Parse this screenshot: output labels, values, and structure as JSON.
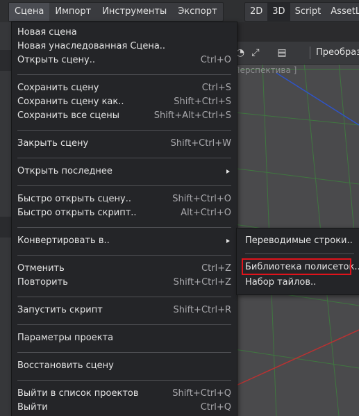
{
  "menubar": {
    "items": [
      "Сцена",
      "Импорт",
      "Инструменты",
      "Экспорт"
    ]
  },
  "modebar": {
    "items": [
      "2D",
      "3D",
      "Script",
      "AssetLib"
    ]
  },
  "viewport": {
    "toolbar_label": "Преобразова",
    "perspective_label": "[ Перспектива ]"
  },
  "scene_menu": {
    "items": [
      {
        "label": "Новая сцена",
        "shortcut": ""
      },
      {
        "label": "Новая унаследованная Сцена..",
        "shortcut": ""
      },
      {
        "label": "Открыть сцену..",
        "shortcut": "Ctrl+O"
      },
      {
        "label": "Сохранить сцену",
        "shortcut": "Ctrl+S"
      },
      {
        "label": "Сохранить сцену как..",
        "shortcut": "Shift+Ctrl+S"
      },
      {
        "label": "Сохранить все сцены",
        "shortcut": "Shift+Alt+Ctrl+S"
      },
      {
        "label": "Закрыть сцену",
        "shortcut": "Shift+Ctrl+W"
      },
      {
        "label": "Открыть последнее",
        "shortcut": ""
      },
      {
        "label": "Быстро открыть сцену..",
        "shortcut": "Shift+Ctrl+O"
      },
      {
        "label": "Быстро открыть скрипт..",
        "shortcut": "Alt+Ctrl+O"
      },
      {
        "label": "Конвертировать в..",
        "shortcut": ""
      },
      {
        "label": "Отменить",
        "shortcut": "Ctrl+Z"
      },
      {
        "label": "Повторить",
        "shortcut": "Shift+Ctrl+Z"
      },
      {
        "label": "Запустить скрипт",
        "shortcut": "Shift+Ctrl+R"
      },
      {
        "label": "Параметры проекта",
        "shortcut": ""
      },
      {
        "label": "Восстановить сцену",
        "shortcut": ""
      },
      {
        "label": "Выйти в список проектов",
        "shortcut": "Shift+Ctrl+Q"
      },
      {
        "label": "Выйти",
        "shortcut": "Ctrl+Q"
      }
    ]
  },
  "convert_submenu": {
    "items": [
      "Переводимые строки..",
      "Библиотека полисеток..",
      "Набор тайлов.."
    ]
  }
}
